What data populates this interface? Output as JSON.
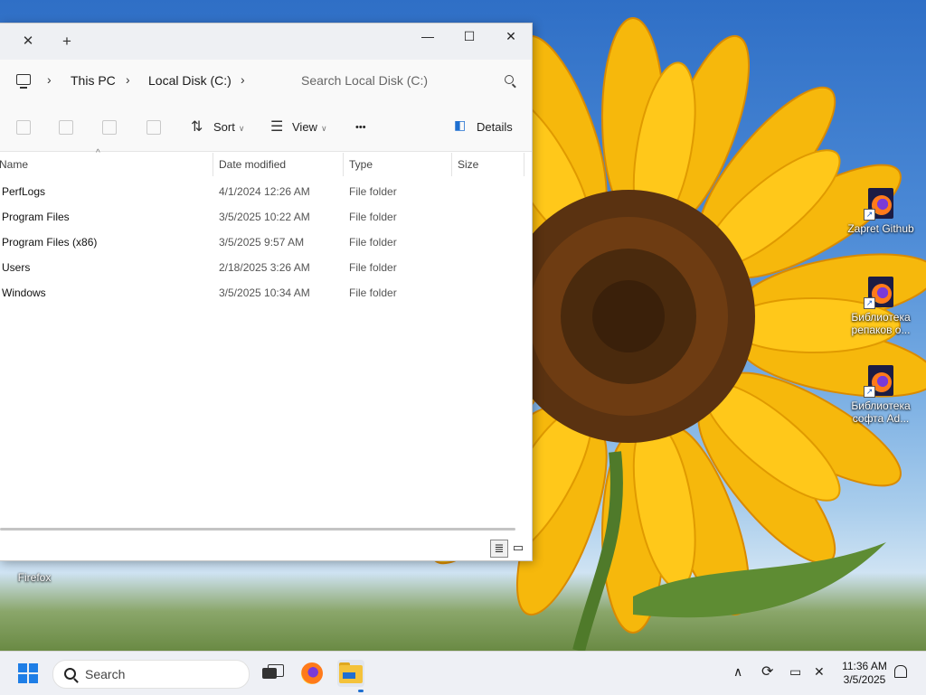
{
  "desktop": {
    "icons": [
      {
        "label": "Zapret Github"
      },
      {
        "label": "Библиотека репаков о..."
      },
      {
        "label": "Библиотека софта Ad..."
      },
      {
        "label": "Firefox"
      }
    ]
  },
  "window": {
    "tab": {
      "close_glyph": "✕",
      "new_glyph": "+"
    },
    "controls": {
      "minimize": "—",
      "maximize": "☐",
      "close": "✕"
    },
    "address": {
      "crumbs": [
        "This PC",
        "Local Disk (C:)"
      ],
      "search_placeholder": "Search Local Disk (C:)"
    },
    "toolbar": {
      "sort": "Sort",
      "view": "View",
      "more": "•••",
      "details": "Details"
    },
    "columns": {
      "name": "Name",
      "date": "Date modified",
      "type": "Type",
      "size": "Size"
    },
    "files": [
      {
        "name": "PerfLogs",
        "date": "4/1/2024 12:26 AM",
        "type": "File folder"
      },
      {
        "name": "Program Files",
        "date": "3/5/2025 10:22 AM",
        "type": "File folder"
      },
      {
        "name": "Program Files (x86)",
        "date": "3/5/2025 9:57 AM",
        "type": "File folder"
      },
      {
        "name": "Users",
        "date": "2/18/2025 3:26 AM",
        "type": "File folder"
      },
      {
        "name": "Windows",
        "date": "3/5/2025 10:34 AM",
        "type": "File folder"
      }
    ]
  },
  "taskbar": {
    "search_label": "Search",
    "clock": {
      "time": "11:36 AM",
      "date": "3/5/2025"
    }
  },
  "colors": {
    "accent": "#1f6fd0",
    "taskbar_bg": "#eef0f5",
    "folder": "#f4c23a"
  }
}
